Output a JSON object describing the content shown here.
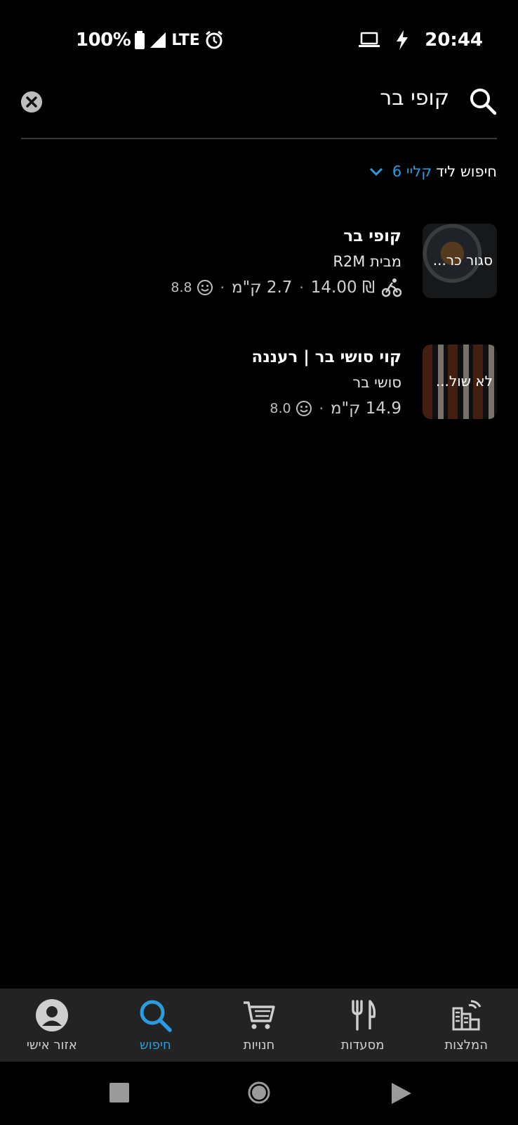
{
  "status_bar": {
    "battery_percent": "100%",
    "network": "LTE",
    "time": "20:44"
  },
  "search": {
    "query": "קופי בר"
  },
  "location": {
    "prefix": "חיפוש ליד",
    "place": "קליי 6"
  },
  "results": [
    {
      "name": "קופי בר",
      "subtitle": "מבית R2M",
      "status": "סגור כר...",
      "delivery_fee": "₪ 14.00",
      "distance": "2.7 ק\"מ",
      "rating": "8.8"
    },
    {
      "name": "קוי סושי בר | רעננה",
      "subtitle": "סושי בר",
      "status": "לא שול...",
      "distance": "14.9 ק\"מ",
      "rating": "8.0"
    }
  ],
  "bottom_nav": {
    "items": [
      {
        "label": "המלצות",
        "icon": "city-icon"
      },
      {
        "label": "מסעדות",
        "icon": "fork-knife-icon"
      },
      {
        "label": "חנויות",
        "icon": "cart-icon"
      },
      {
        "label": "חיפוש",
        "icon": "search-icon",
        "active": true
      },
      {
        "label": "אזור אישי",
        "icon": "person-icon"
      }
    ]
  },
  "colors": {
    "accent": "#2a9ce0",
    "background": "#000000",
    "nav_background": "#232323"
  }
}
